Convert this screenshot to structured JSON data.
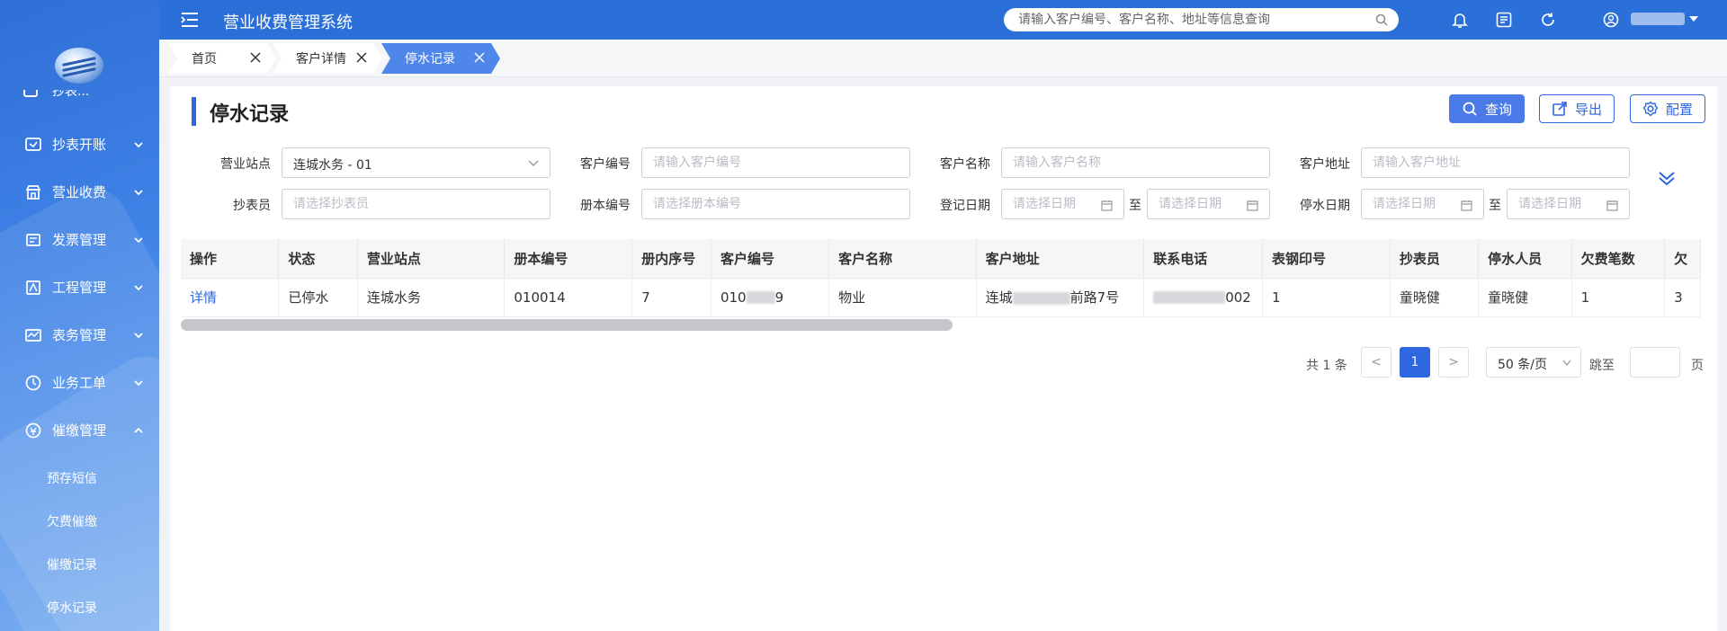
{
  "app": {
    "title": "营业收费管理系统"
  },
  "header": {
    "search_placeholder": "请输入客户编号、客户名称、地址等信息查询"
  },
  "sidebar": {
    "cut_item_label": "抄表...",
    "items": [
      {
        "label": "抄表开账",
        "icon": "meter-reading-icon"
      },
      {
        "label": "营业收费",
        "icon": "storefront-icon"
      },
      {
        "label": "发票管理",
        "icon": "invoice-icon"
      },
      {
        "label": "工程管理",
        "icon": "engineering-icon"
      },
      {
        "label": "表务管理",
        "icon": "meter-service-icon"
      },
      {
        "label": "业务工单",
        "icon": "work-order-icon"
      },
      {
        "label": "催缴管理",
        "icon": "collection-icon"
      }
    ],
    "submenu": [
      "预存短信",
      "欠费催缴",
      "催缴记录",
      "停水记录"
    ]
  },
  "tabs": [
    {
      "label": "首页",
      "close": "X"
    },
    {
      "label": "客户详情",
      "close": "X"
    },
    {
      "label": "停水记录",
      "close": "X",
      "active": true
    }
  ],
  "page": {
    "title": "停水记录",
    "buttons": {
      "query": "查询",
      "export": "导出",
      "config": "配置"
    }
  },
  "filters": {
    "station": {
      "label": "营业站点",
      "value": "连城水务 - 01"
    },
    "customer_no": {
      "label": "客户编号",
      "placeholder": "请输入客户编号"
    },
    "customer_name": {
      "label": "客户名称",
      "placeholder": "请输入客户名称"
    },
    "customer_addr": {
      "label": "客户地址",
      "placeholder": "请输入客户地址"
    },
    "reader": {
      "label": "抄表员",
      "placeholder": "请选择抄表员"
    },
    "book_no": {
      "label": "册本编号",
      "placeholder": "请选择册本编号"
    },
    "reg_date": {
      "label": "登记日期",
      "from_placeholder": "请选择日期",
      "to_placeholder": "请选择日期"
    },
    "stop_date": {
      "label": "停水日期",
      "from_placeholder": "请选择日期",
      "to_placeholder": "请选择日期"
    },
    "to_text": "至"
  },
  "table": {
    "headers": [
      "操作",
      "状态",
      "营业站点",
      "册本编号",
      "册内序号",
      "客户编号",
      "客户名称",
      "客户地址",
      "联系电话",
      "表钢印号",
      "抄表员",
      "停水人员",
      "欠费笔数",
      "欠"
    ],
    "rows": [
      {
        "action": "详情",
        "status": "已停水",
        "station": "连城水务",
        "book_no": "010014",
        "seq": "7",
        "customer_no_a": "010",
        "customer_no_b": "9",
        "customer_name": "物业",
        "address_a": "连城",
        "address_b": "前路7号",
        "phone_b": "002",
        "meter_seal": "1",
        "reader": "童晓健",
        "stopper": "童晓健",
        "arrears_count": "1",
        "arrears_more": "3"
      }
    ]
  },
  "pagination": {
    "total": "共 1 条",
    "current_page": "1",
    "page_size": "50 条/页",
    "jump_label": "跳至",
    "page_label": "页",
    "prev": "<",
    "next": ">"
  },
  "colors": {
    "primary": "#2f67e0",
    "header_bg": "#2b6fd8",
    "active_tab": "#4f86ea"
  }
}
